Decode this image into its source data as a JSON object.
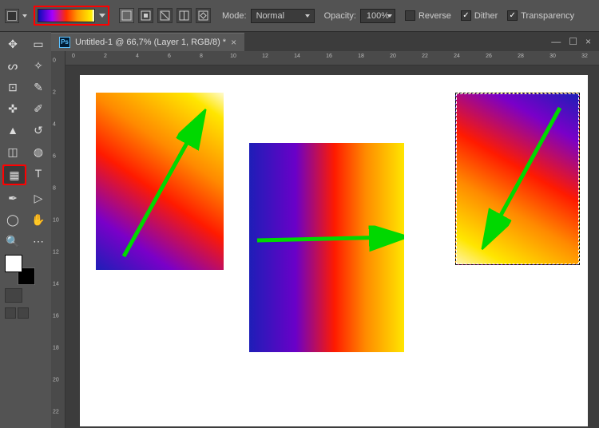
{
  "options_bar": {
    "mode_label": "Mode:",
    "mode_value": "Normal",
    "opacity_label": "Opacity:",
    "opacity_value": "100%",
    "reverse_label": "Reverse",
    "reverse_checked": false,
    "dither_label": "Dither",
    "dither_checked": true,
    "transparency_label": "Transparency",
    "transparency_checked": true,
    "gradient_styles": [
      "linear",
      "radial",
      "angular",
      "reflected",
      "diamond"
    ],
    "gradient_preset": "blue-red-yellow"
  },
  "tools": {
    "rows": [
      [
        "move",
        "marquee"
      ],
      [
        "lasso",
        "magic-wand"
      ],
      [
        "crop",
        "eyedropper"
      ],
      [
        "healing",
        "brush"
      ],
      [
        "stamp",
        "history-brush"
      ],
      [
        "eraser",
        "bucket"
      ],
      [
        "gradient",
        "type"
      ],
      [
        "pen",
        "path-select"
      ],
      [
        "shape",
        "hand"
      ],
      [
        "zoom",
        "empty"
      ]
    ],
    "selected": "gradient"
  },
  "document": {
    "ps_badge": "Ps",
    "title": "Untitled-1 @ 66,7% (Layer 1, RGB/8) *",
    "ruler_h": [
      "0",
      "2",
      "4",
      "6",
      "8",
      "10",
      "12",
      "14",
      "16",
      "18",
      "20",
      "22",
      "24",
      "26",
      "28",
      "30",
      "32"
    ],
    "ruler_v": [
      "0",
      "2",
      "4",
      "6",
      "8",
      "10",
      "12",
      "14",
      "16",
      "18",
      "20",
      "22"
    ]
  }
}
